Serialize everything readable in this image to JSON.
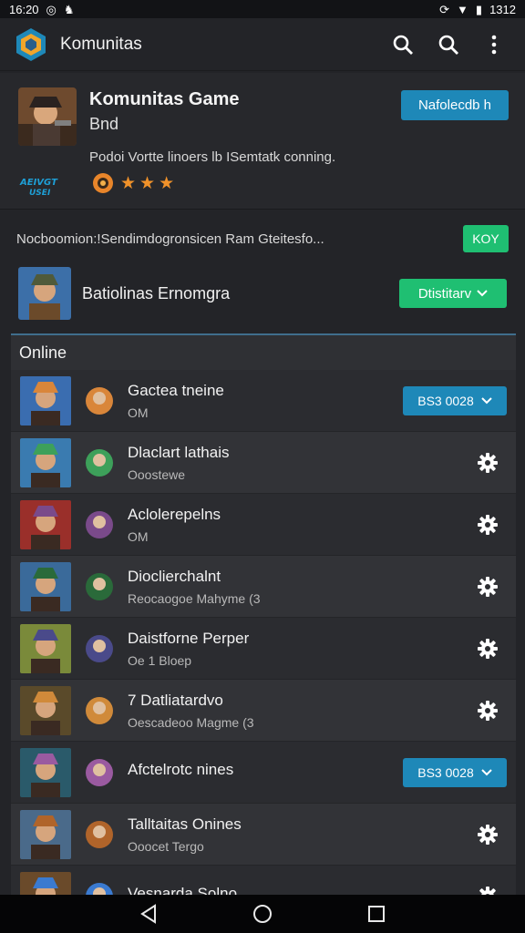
{
  "status_bar": {
    "time": "16:20",
    "battery": "1312"
  },
  "app": {
    "title": "Komunitas"
  },
  "game": {
    "title": "Komunitas Game",
    "subtitle": "Bnd",
    "description": "Podoi Vortte linoers lb ISemtatk conning.",
    "action_label": "Nafolecdb h",
    "brand_logo_text": "AEIVGT USEI",
    "rating_stars": 3
  },
  "notice": {
    "text": "Nocboomion:!Sendimdogronsicen Ram Gteitesfo...",
    "button_label": "KOY"
  },
  "featured": {
    "name": "Batiolinas Ernomgra",
    "button_label": "Dtistitarv"
  },
  "online": {
    "header": "Online",
    "rows": [
      {
        "name": "Gactea tneine",
        "status": "OM",
        "action": "button",
        "button_label": "BS3 0028"
      },
      {
        "name": "Dlaclart lathais",
        "status": "Ooostewe",
        "action": "gear"
      },
      {
        "name": "Aclolerepelns",
        "status": "OM",
        "action": "gear"
      },
      {
        "name": "Dioclierchalnt",
        "status": "Reocaogoe Mahyme (3",
        "action": "gear"
      },
      {
        "name": "Daistforne Perper",
        "status": "Oe 1 Bloep",
        "action": "gear"
      },
      {
        "name": "7 Datliatardvo",
        "status": "Oescadeoo Magme (3",
        "action": "gear"
      },
      {
        "name": "Afctelrotc nines",
        "status": "",
        "action": "button",
        "button_label": "BS3 0028"
      },
      {
        "name": "Talltaitas Onines",
        "status": "Ooocet Tergo",
        "action": "gear"
      },
      {
        "name": "Vesnarda Solno",
        "status": "",
        "action": "gear"
      }
    ]
  },
  "colors": {
    "accent_blue": "#1e88b8",
    "accent_green": "#1fbf72",
    "star_orange": "#f0922a",
    "background": "#232428"
  }
}
